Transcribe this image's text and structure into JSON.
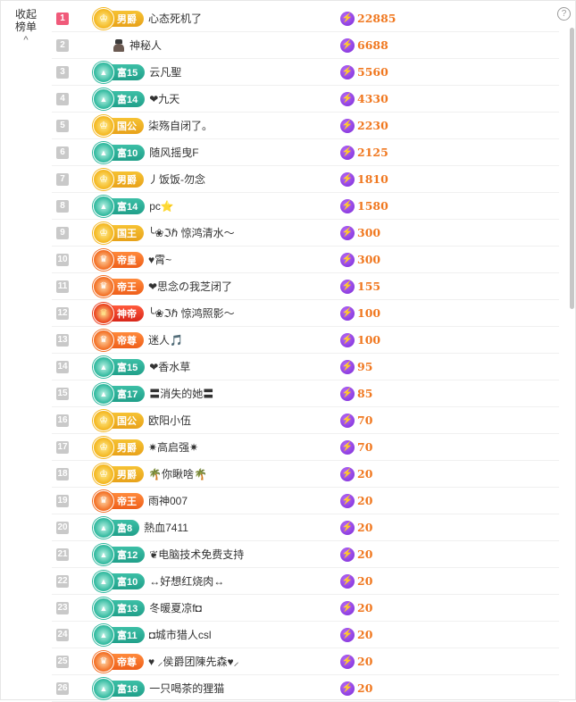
{
  "collapse": {
    "line1": "收起",
    "line2": "榜单",
    "arrow": "^"
  },
  "help_glyph": "?",
  "bolt_glyph": "⚡",
  "rows": [
    {
      "rank": "1",
      "badge": "男爵",
      "style": "gold",
      "name": "心态死机了",
      "score": "22885"
    },
    {
      "rank": "2",
      "badge": "",
      "style": "mystery",
      "name": "神秘人",
      "score": "6688"
    },
    {
      "rank": "3",
      "badge": "富15",
      "style": "teal",
      "name": "云凡聖",
      "score": "5560"
    },
    {
      "rank": "4",
      "badge": "富14",
      "style": "teal",
      "name": "❤九天",
      "score": "4330"
    },
    {
      "rank": "5",
      "badge": "国公",
      "style": "gold",
      "name": "柒殇自闭了。",
      "score": "2230"
    },
    {
      "rank": "6",
      "badge": "富10",
      "style": "teal",
      "name": "随风摇曳F",
      "score": "2125"
    },
    {
      "rank": "7",
      "badge": "男爵",
      "style": "gold",
      "name": "丿饭饭-勿念",
      "score": "1810"
    },
    {
      "rank": "8",
      "badge": "富14",
      "style": "teal",
      "name": "pc⭐",
      "score": "1580"
    },
    {
      "rank": "9",
      "badge": "国王",
      "style": "gold",
      "name": "╰❀ℑℏ 惊鸿清水～",
      "score": "300"
    },
    {
      "rank": "10",
      "badge": "帝皇",
      "style": "orange",
      "name": "♥霄~",
      "score": "300"
    },
    {
      "rank": "11",
      "badge": "帝王",
      "style": "orange",
      "name": "❤思念の我芝闭了",
      "score": "155"
    },
    {
      "rank": "12",
      "badge": "神帝",
      "style": "red",
      "name": "╰❀ℑℏ 惊鸿照影～",
      "score": "100"
    },
    {
      "rank": "13",
      "badge": "帝尊",
      "style": "orange",
      "name": "迷人🎵",
      "score": "100"
    },
    {
      "rank": "14",
      "badge": "富15",
      "style": "teal",
      "name": "❤香水草",
      "score": "95"
    },
    {
      "rank": "15",
      "badge": "富17",
      "style": "teal",
      "name": "〓消失的她〓",
      "score": "85"
    },
    {
      "rank": "16",
      "badge": "国公",
      "style": "gold",
      "name": "欧阳小伍",
      "score": "70"
    },
    {
      "rank": "17",
      "badge": "男爵",
      "style": "gold",
      "name": "✷高启强✷",
      "score": "70"
    },
    {
      "rank": "18",
      "badge": "男爵",
      "style": "gold",
      "name": "🌴你瞅啥🌴",
      "score": "20"
    },
    {
      "rank": "19",
      "badge": "帝王",
      "style": "orange",
      "name": "雨神007",
      "score": "20"
    },
    {
      "rank": "20",
      "badge": "富8",
      "style": "teal",
      "name": "熱血7411",
      "score": "20"
    },
    {
      "rank": "21",
      "badge": "富12",
      "style": "teal",
      "name": "❦电脑技术免费支持",
      "score": "20"
    },
    {
      "rank": "22",
      "badge": "富10",
      "style": "teal",
      "name": "↔好想红烧肉↔",
      "score": "20"
    },
    {
      "rank": "23",
      "badge": "富13",
      "style": "teal",
      "name": "冬暖夏凉f◘",
      "score": "20"
    },
    {
      "rank": "24",
      "badge": "富11",
      "style": "teal",
      "name": "◘城市猎人csl",
      "score": "20"
    },
    {
      "rank": "25",
      "badge": "帝尊",
      "style": "orange",
      "name": "♥ ⸝侯爵团陳先森♥⸝",
      "score": "20"
    },
    {
      "rank": "26",
      "badge": "富18",
      "style": "teal",
      "name": "一只喝茶的狸猫",
      "score": "20"
    }
  ]
}
